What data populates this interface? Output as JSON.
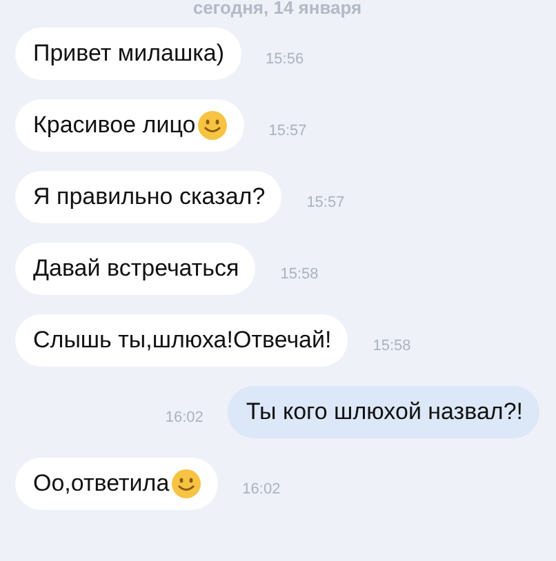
{
  "date_header": "сегодня, 14 января",
  "messages": [
    {
      "kind": "incoming",
      "text": "Привет милашка)",
      "time": "15:56",
      "emoji": false
    },
    {
      "kind": "incoming",
      "text": "Красивое лицо",
      "time": "15:57",
      "emoji": true
    },
    {
      "kind": "incoming",
      "text": "Я правильно сказал?",
      "time": "15:57",
      "emoji": false
    },
    {
      "kind": "incoming",
      "text": "Давай встречаться",
      "time": "15:58",
      "emoji": false
    },
    {
      "kind": "incoming",
      "text": "Слышь ты,шлюха!Отвечай!",
      "time": "15:58",
      "emoji": false
    },
    {
      "kind": "outgoing",
      "text": "Ты кого шлюхой назвал?!",
      "time": "16:02",
      "emoji": false
    },
    {
      "kind": "incoming",
      "text": "Оо,ответила",
      "time": "16:02",
      "emoji": true
    }
  ]
}
